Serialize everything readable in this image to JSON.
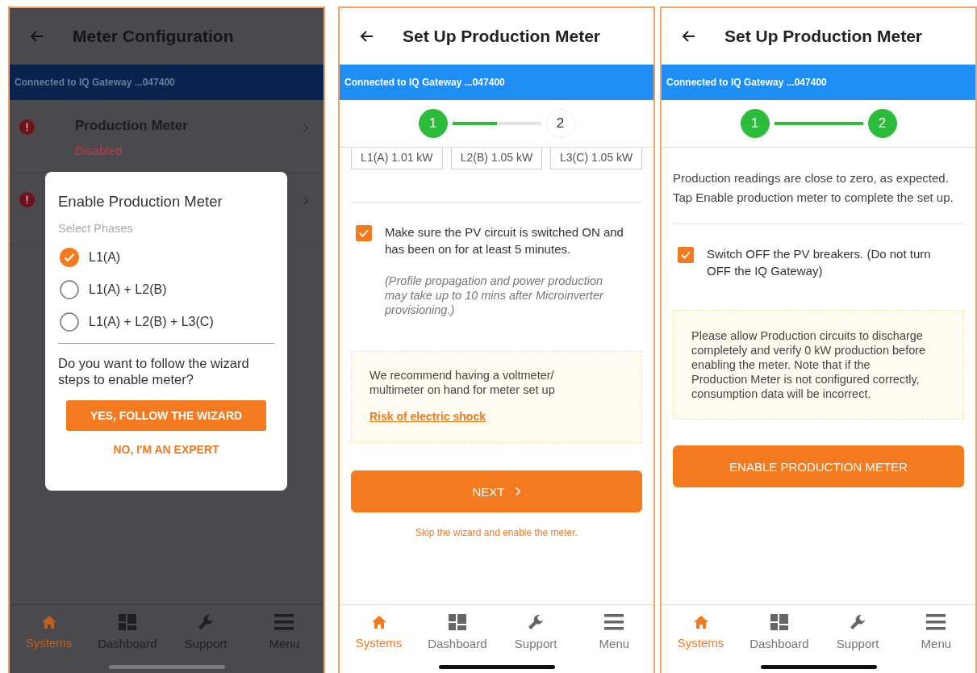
{
  "screens": [
    {
      "kind": "meter_list",
      "title": "Meter Configuration",
      "banner": "Connected to IQ Gateway ...047400",
      "rows": [
        {
          "title": "Production Meter",
          "status": "Disabled",
          "alert": true
        },
        {
          "alert": true
        }
      ],
      "modal": {
        "title": "Enable Production Meter",
        "subtitle": "Select Phases",
        "options": [
          {
            "label": "L1(A)",
            "selected": true
          },
          {
            "label": "L1(A) + L2(B)",
            "selected": false
          },
          {
            "label": "L1(A) + L2(B) + L3(C)",
            "selected": false
          }
        ],
        "question": "Do you want to follow the wizard steps to enable meter?",
        "primary": "YES, FOLLOW THE WIZARD",
        "secondary": "NO, I'M AN EXPERT"
      },
      "nav": [
        {
          "label": "Systems",
          "selected": true
        },
        {
          "label": "Dashboard",
          "selected": false
        },
        {
          "label": "Support",
          "selected": false
        },
        {
          "label": "Menu",
          "selected": false
        }
      ]
    },
    {
      "kind": "wizard_step1",
      "title": "Set Up Production Meter",
      "banner": "Connected to IQ Gateway ...047400",
      "steps": [
        {
          "label": "1",
          "done": true
        },
        {
          "label": "2",
          "done": false
        }
      ],
      "progress": {
        "level": 0.5
      },
      "readings": [
        "L1(A) 1.01 kW",
        "L2(B) 1.05 kW",
        "L3(C) 1.05 kW"
      ],
      "check": {
        "label": "Make sure the PV circuit is switched ON and has been on for at least 5 minutes.",
        "checked": true
      },
      "note": "(Profile propagation and power production may take up to 10 mins after Microinverter provisioning.)",
      "tip": {
        "text": "We recommend having a voltmeter/ multimeter on hand for meter set up",
        "link": "Risk of electric shock"
      },
      "button": "NEXT",
      "skip": "Skip the wizard and enable the meter.",
      "nav": [
        {
          "label": "Systems",
          "selected": true
        },
        {
          "label": "Dashboard",
          "selected": false
        },
        {
          "label": "Support",
          "selected": false
        },
        {
          "label": "Menu",
          "selected": false
        }
      ]
    },
    {
      "kind": "wizard_step2",
      "title": "Set Up Production Meter",
      "banner": "Connected to IQ Gateway ...047400",
      "steps": [
        {
          "label": "1",
          "done": true
        },
        {
          "label": "2",
          "done": true
        }
      ],
      "progress": {
        "level": 1
      },
      "intro": "Production readings are close to zero, as expected. Tap Enable production meter to complete the set up.",
      "check": {
        "label": "Switch OFF the PV breakers. (Do not turn OFF the IQ Gateway)",
        "checked": true
      },
      "tip": {
        "text": "Please allow Production circuits to discharge completely and verify 0 kW production before enabling the meter. Note that if the Production Meter is not configured correctly, consumption data will be incorrect."
      },
      "button": "ENABLE PRODUCTION METER",
      "nav": [
        {
          "label": "Systems",
          "selected": true
        },
        {
          "label": "Dashboard",
          "selected": false
        },
        {
          "label": "Support",
          "selected": false
        },
        {
          "label": "Menu",
          "selected": false
        }
      ]
    }
  ]
}
